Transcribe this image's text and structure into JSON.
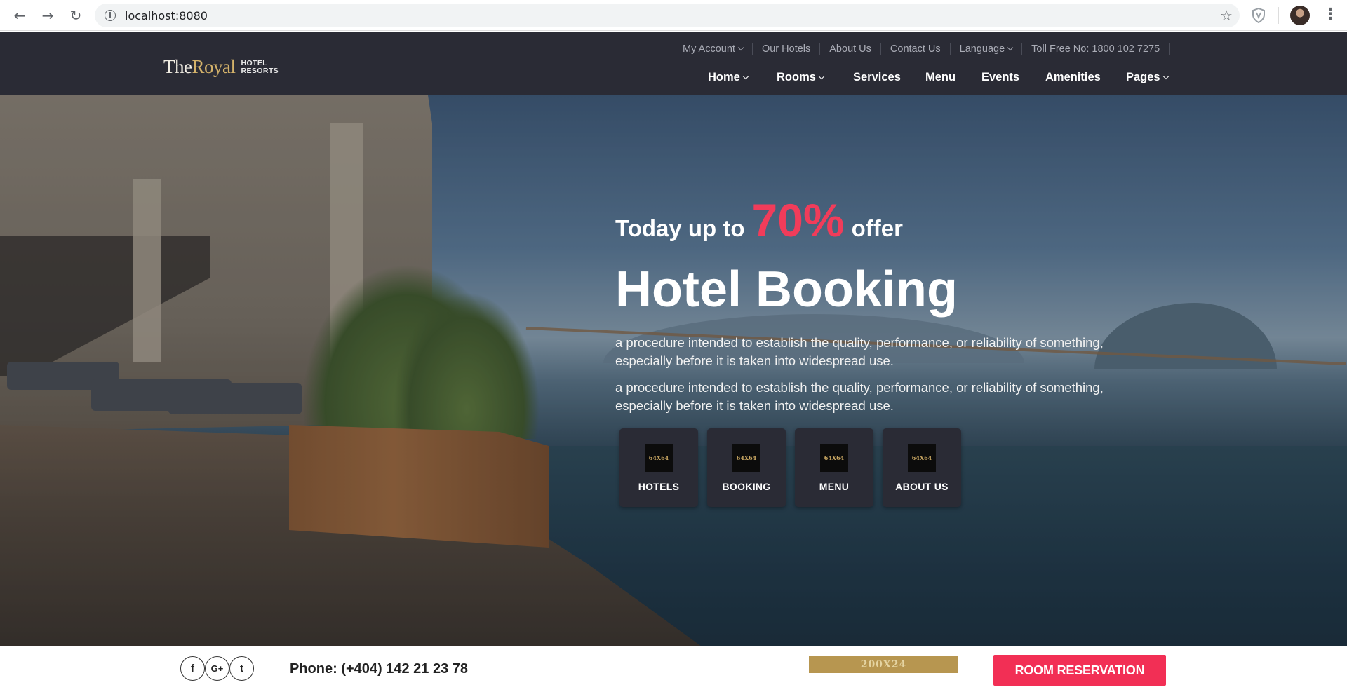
{
  "browser": {
    "url": "localhost:8080",
    "icons": [
      "back-icon",
      "forward-icon",
      "reload-icon",
      "info-icon",
      "star-icon",
      "shield-extension-icon",
      "profile-avatar",
      "more-icon"
    ]
  },
  "brand": {
    "the": "The",
    "royal": "Royal",
    "hotel": "HOTEL",
    "resorts": "RESORTS",
    "colors": {
      "header": "#2a2b35",
      "gold": "#d4b26a",
      "accent": "#f13c5a"
    }
  },
  "top_nav": {
    "my_account": "My Account",
    "our_hotels": "Our Hotels",
    "about_us": "About Us",
    "contact_us": "Contact Us",
    "language": "Language",
    "toll_free": "Toll Free No: 1800 102 7275"
  },
  "main_nav": {
    "home": "Home",
    "rooms": "Rooms",
    "services": "Services",
    "menu": "Menu",
    "events": "Events",
    "amenities": "Amenities",
    "pages": "Pages"
  },
  "hero": {
    "offer_prefix": "Today up to",
    "offer_percent": "70%",
    "offer_suffix": "offer",
    "title": "Hotel Booking",
    "desc1": "a procedure intended to establish the quality, performance, or reliability of something, especially before it is taken into widespread use.",
    "desc2": "a procedure intended to establish the quality, performance, or reliability of something, especially before it is taken into widespread use.",
    "tiles": [
      {
        "icon": "64X64",
        "label": "HOTELS"
      },
      {
        "icon": "64X64",
        "label": "BOOKING"
      },
      {
        "icon": "64X64",
        "label": "MENU"
      },
      {
        "icon": "64X64",
        "label": "ABOUT US"
      }
    ]
  },
  "bottom_bar": {
    "social": {
      "facebook": "f",
      "google_plus": "G+",
      "twitter": "t"
    },
    "phone": "Phone: (+404) 142 21 23 78",
    "placeholder": "200X24",
    "reservation": "ROOM RESERVATION"
  }
}
